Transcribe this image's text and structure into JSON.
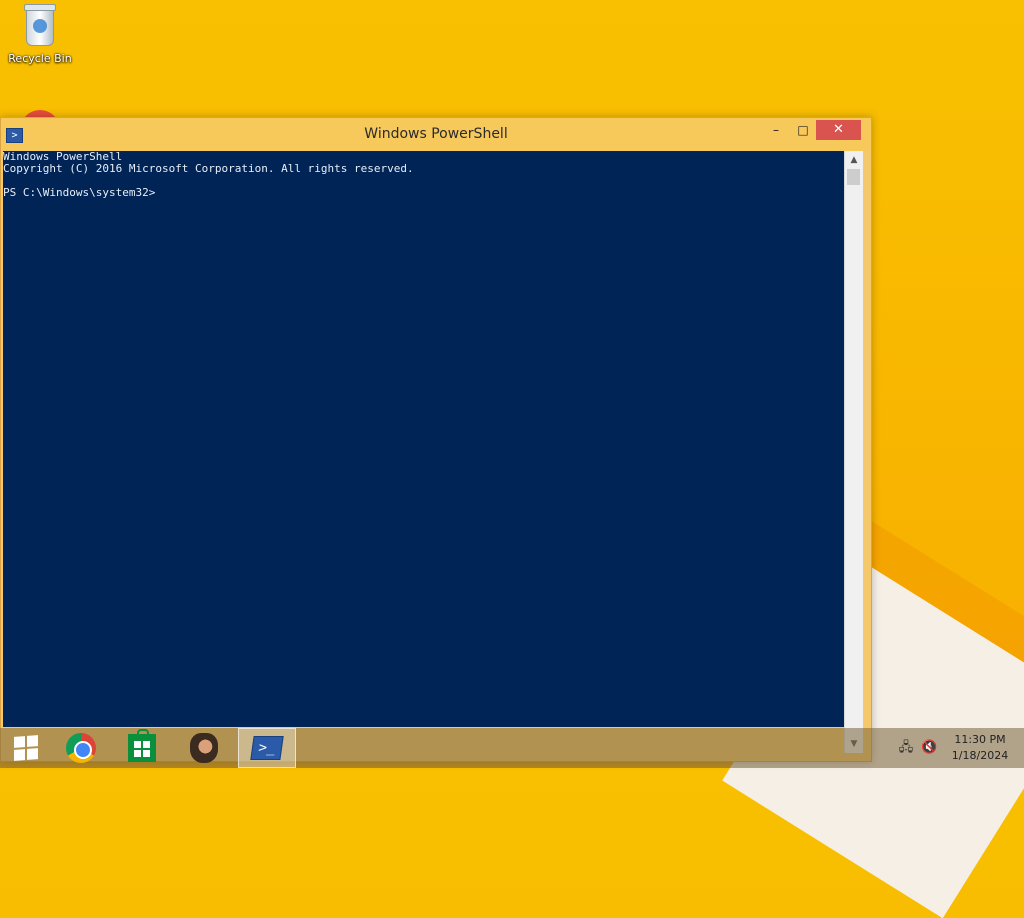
{
  "desktop": {
    "recycle_bin_label": "Recycle Bin"
  },
  "window": {
    "title": "Windows PowerShell",
    "controls": {
      "minimize": "–",
      "maximize": "□",
      "close": "✕"
    },
    "console_lines": [
      "Windows PowerShell",
      "Copyright (C) 2016 Microsoft Corporation. All rights reserved.",
      "",
      "PS C:\\Windows\\system32>"
    ]
  },
  "taskbar": {
    "pinned": [
      {
        "name": "start-button",
        "icon": "windows-logo-icon"
      },
      {
        "name": "chrome",
        "icon": "chrome-icon"
      },
      {
        "name": "store",
        "icon": "store-icon"
      },
      {
        "name": "app",
        "icon": "character-app-icon"
      },
      {
        "name": "powershell",
        "icon": "powershell-icon",
        "active": true
      }
    ],
    "clock_time": "11:30 PM",
    "clock_date": "1/18/2024"
  },
  "colors": {
    "console_bg": "#012456",
    "desktop_bg": "#f8c000",
    "close_red": "#d9534f"
  }
}
